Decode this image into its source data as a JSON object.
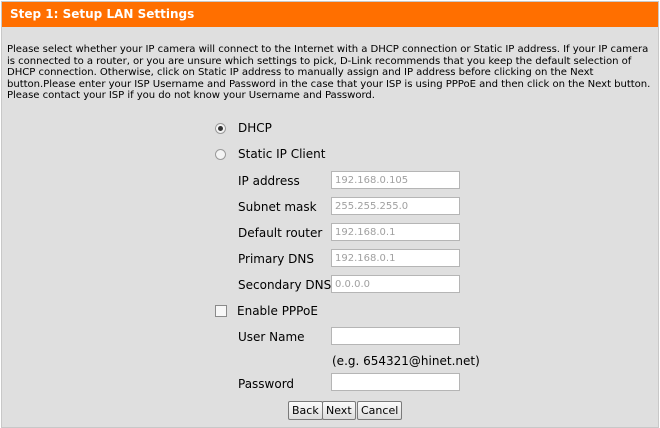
{
  "header": {
    "title": "Step 1: Setup LAN Settings"
  },
  "description": "Please select whether your IP camera will connect to the Internet with a DHCP connection or Static IP address. If your IP camera is connected to a router, or you are unsure which settings to pick, D-Link recommends that you keep the default selection of DHCP connection. Otherwise, click on Static IP address to manually assign and IP address before clicking on the Next button.Please enter your ISP Username and Password in the case that your ISP is using PPPoE and then click on the Next button. Please contact your ISP if you do not know your Username and Password.",
  "connection": {
    "dhcp_label": "DHCP",
    "dhcp_selected": true,
    "static_label": "Static IP Client",
    "static_selected": false
  },
  "static_fields": {
    "ip_label": "IP address",
    "ip_value": "192.168.0.105",
    "mask_label": "Subnet mask",
    "mask_value": "255.255.255.0",
    "router_label": "Default router",
    "router_value": "192.168.0.1",
    "primary_dns_label": "Primary DNS",
    "primary_dns_value": "192.168.0.1",
    "secondary_dns_label": "Secondary DNS",
    "secondary_dns_value": "0.0.0.0"
  },
  "pppoe": {
    "enable_label": "Enable PPPoE",
    "enabled": false,
    "username_label": "User Name",
    "username_value": "",
    "hint": "(e.g. 654321@hinet.net)",
    "password_label": "Password",
    "password_value": ""
  },
  "buttons": {
    "back": "Back",
    "next": "Next",
    "cancel": "Cancel"
  },
  "colors": {
    "header": "#ff6f00",
    "panel": "#dfdfdf"
  }
}
